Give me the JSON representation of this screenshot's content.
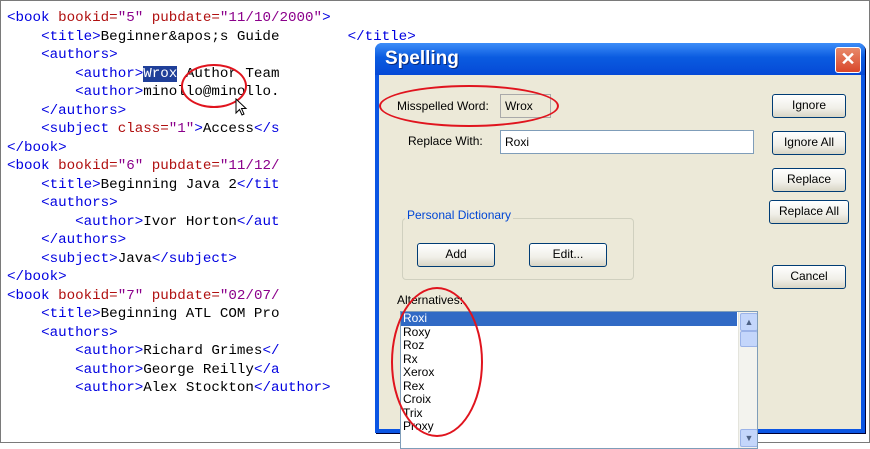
{
  "editor": {
    "lines": [
      [
        {
          "c": "t",
          "s": "<book "
        },
        {
          "c": "a",
          "s": "bookid="
        },
        {
          "c": "v",
          "s": "\"5\" "
        },
        {
          "c": "a",
          "s": "pubdate="
        },
        {
          "c": "v",
          "s": "\"11/10/2000\""
        },
        {
          "c": "t",
          "s": ">"
        }
      ],
      [
        {
          "c": "",
          "s": "    "
        },
        {
          "c": "t",
          "s": "<title>"
        },
        {
          "c": "",
          "s": "Beginner&apos;s Guide "
        },
        {
          "c": "t",
          "s": "  "
        },
        {
          "c": "",
          "s": "     "
        },
        {
          "c": "t",
          "s": "</title>"
        }
      ],
      [
        {
          "c": "",
          "s": "    "
        },
        {
          "c": "t",
          "s": "<authors>"
        }
      ],
      [
        {
          "c": "",
          "s": "        "
        },
        {
          "c": "t",
          "s": "<author>"
        },
        {
          "c": "sel",
          "s": "Wrox"
        },
        {
          "c": "",
          "s": " Author Team"
        }
      ],
      [
        {
          "c": "",
          "s": "        "
        },
        {
          "c": "t",
          "s": "<author>"
        },
        {
          "c": "",
          "s": "minollo@minollo."
        }
      ],
      [
        {
          "c": "",
          "s": "    "
        },
        {
          "c": "t",
          "s": "</authors>"
        }
      ],
      [
        {
          "c": "",
          "s": "    "
        },
        {
          "c": "t",
          "s": "<subject "
        },
        {
          "c": "a",
          "s": "class="
        },
        {
          "c": "v",
          "s": "\"1\""
        },
        {
          "c": "t",
          "s": ">"
        },
        {
          "c": "",
          "s": "Access"
        },
        {
          "c": "t",
          "s": "</s"
        }
      ],
      [
        {
          "c": "t",
          "s": "</book>"
        }
      ],
      [
        {
          "c": "t",
          "s": "<book "
        },
        {
          "c": "a",
          "s": "bookid="
        },
        {
          "c": "v",
          "s": "\"6\" "
        },
        {
          "c": "a",
          "s": "pubdate="
        },
        {
          "c": "v",
          "s": "\"11/12/"
        }
      ],
      [
        {
          "c": "",
          "s": "    "
        },
        {
          "c": "t",
          "s": "<title>"
        },
        {
          "c": "",
          "s": "Beginning Java 2"
        },
        {
          "c": "t",
          "s": "</tit"
        }
      ],
      [
        {
          "c": "",
          "s": "    "
        },
        {
          "c": "t",
          "s": "<authors>"
        }
      ],
      [
        {
          "c": "",
          "s": "        "
        },
        {
          "c": "t",
          "s": "<author>"
        },
        {
          "c": "",
          "s": "Ivor Horton"
        },
        {
          "c": "t",
          "s": "</aut"
        }
      ],
      [
        {
          "c": "",
          "s": "    "
        },
        {
          "c": "t",
          "s": "</authors>"
        }
      ],
      [
        {
          "c": "",
          "s": "    "
        },
        {
          "c": "t",
          "s": "<subject>"
        },
        {
          "c": "",
          "s": "Java"
        },
        {
          "c": "t",
          "s": "</subject>"
        }
      ],
      [
        {
          "c": "t",
          "s": "</book>"
        }
      ],
      [
        {
          "c": "t",
          "s": "<book "
        },
        {
          "c": "a",
          "s": "bookid="
        },
        {
          "c": "v",
          "s": "\"7\" "
        },
        {
          "c": "a",
          "s": "pubdate="
        },
        {
          "c": "v",
          "s": "\"02/07/"
        }
      ],
      [
        {
          "c": "",
          "s": "    "
        },
        {
          "c": "t",
          "s": "<title>"
        },
        {
          "c": "",
          "s": "Beginning ATL COM Pro"
        }
      ],
      [
        {
          "c": "",
          "s": "    "
        },
        {
          "c": "t",
          "s": "<authors>"
        }
      ],
      [
        {
          "c": "",
          "s": "        "
        },
        {
          "c": "t",
          "s": "<author>"
        },
        {
          "c": "",
          "s": "Richard Grimes"
        },
        {
          "c": "t",
          "s": "</"
        }
      ],
      [
        {
          "c": "",
          "s": "        "
        },
        {
          "c": "t",
          "s": "<author>"
        },
        {
          "c": "",
          "s": "George Reilly"
        },
        {
          "c": "t",
          "s": "</a"
        }
      ],
      [
        {
          "c": "",
          "s": "        "
        },
        {
          "c": "t",
          "s": "<author>"
        },
        {
          "c": "",
          "s": "Alex Stockton"
        },
        {
          "c": "t",
          "s": "</author>"
        }
      ]
    ]
  },
  "dialog": {
    "title": "Spelling",
    "close_glyph": "✕",
    "misspelled_label": "Misspelled Word:",
    "misspelled_value": "Wrox",
    "replace_label": "Replace With:",
    "replace_value": "Roxi",
    "personal_dictionary_label": "Personal Dictionary",
    "add_label": "Add",
    "edit_label": "Edit...",
    "alternatives_label": "Alternatives:",
    "alternatives": [
      "Roxi",
      "Roxy",
      "Roz",
      "Rx",
      "Xerox",
      "Rex",
      "Croix",
      "Trix",
      "Proxy"
    ],
    "selected_alternative": "Roxi",
    "ignore_label": "Ignore",
    "ignore_all_label": "Ignore All",
    "replace_button_label": "Replace",
    "replace_all_label": "Replace All",
    "cancel_label": "Cancel"
  },
  "colors": {
    "annotation": "#e0141e",
    "titlebar": "#0a5be0",
    "selection": "#316ac5"
  }
}
